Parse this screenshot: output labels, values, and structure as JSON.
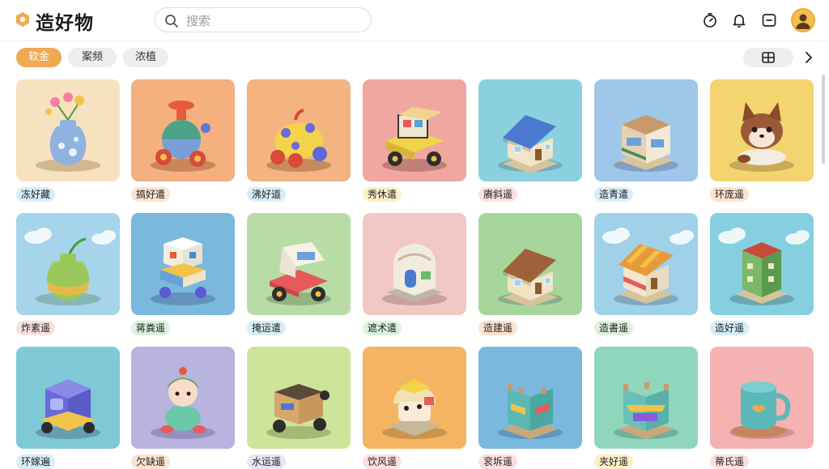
{
  "header": {
    "app_title": "造好物",
    "search": {
      "placeholder": "搜索",
      "value": ""
    },
    "icons": [
      "logo-icon",
      "search-icon",
      "timer-icon",
      "bell-icon",
      "message-icon",
      "user-avatar"
    ]
  },
  "chips": [
    {
      "label": "软金",
      "active": true
    },
    {
      "label": "案频",
      "active": false
    },
    {
      "label": "浓植",
      "active": false
    }
  ],
  "toolbar": {
    "view_icon": "grid-view-icon",
    "next_icon": "chevron-right-icon"
  },
  "colors": {
    "accent": "#f0a950",
    "chip_idle": "#eeeeee"
  },
  "grid": [
    {
      "label": "冻好藏",
      "bg": "#f7e2bf",
      "label_bg": "#d6eef8",
      "item": "vase-flowers"
    },
    {
      "label": "搞好遣",
      "bg": "#f5b07f",
      "label_bg": "#fbe3cf",
      "item": "toy-robot"
    },
    {
      "label": "沸好道",
      "bg": "#f3b482",
      "label_bg": "#d6eef8",
      "item": "toy-car-yellow"
    },
    {
      "label": "秀休遣",
      "bg": "#f0a7a0",
      "label_bg": "#fbf1c5",
      "item": "toy-truck"
    },
    {
      "label": "赓斜遥",
      "bg": "#8ad0df",
      "label_bg": "#fbe0e0",
      "item": "house-blue-roof"
    },
    {
      "label": "造青遣",
      "bg": "#9ec7ea",
      "label_bg": "#d6eef8",
      "item": "shop-building"
    },
    {
      "label": "环庞遥",
      "bg": "#f3d46f",
      "label_bg": "#fbe3cf",
      "item": "puppy"
    },
    {
      "label": "炸素遥",
      "bg": "#a5d4eb",
      "label_bg": "#fbe0e0",
      "item": "green-vase"
    },
    {
      "label": "蒋粪遥",
      "bg": "#7ab8dc",
      "label_bg": "#dcf2dc",
      "item": "toy-tower"
    },
    {
      "label": "掩运遣",
      "bg": "#b9dca7",
      "label_bg": "#d6eef8",
      "item": "toy-van"
    },
    {
      "label": "遮术遣",
      "bg": "#f2c8c4",
      "label_bg": "#dcf2dc",
      "item": "dome-house"
    },
    {
      "label": "造建遥",
      "bg": "#a7d69c",
      "label_bg": "#fbe3cf",
      "item": "cottage"
    },
    {
      "label": "造書遥",
      "bg": "#9fd1e8",
      "label_bg": "#dcf2dc",
      "item": "market-stall"
    },
    {
      "label": "造好遥",
      "bg": "#86cfe0",
      "label_bg": "#d6eef8",
      "item": "green-tower"
    },
    {
      "label": "环嫁遍",
      "bg": "#7fc9d6",
      "label_bg": "#d6eef8",
      "item": "purple-cube-car"
    },
    {
      "label": "欠缺遥",
      "bg": "#b9b4df",
      "label_bg": "#fbe3cf",
      "item": "doll"
    },
    {
      "label": "水运遥",
      "bg": "#cde49a",
      "label_bg": "#e5e5f5",
      "item": "wooden-cart"
    },
    {
      "label": "饮风遥",
      "bg": "#f5b461",
      "label_bg": "#fbe0e0",
      "item": "mushroom-house"
    },
    {
      "label": "衮坼遥",
      "bg": "#79b9e0",
      "label_bg": "#fbe0e0",
      "item": "castle-shop"
    },
    {
      "label": "夹好遥",
      "bg": "#8fd6bd",
      "label_bg": "#fbf1c5",
      "item": "castle-stall"
    },
    {
      "label": "蒂氏遥",
      "bg": "#f4b2b2",
      "label_bg": "#fbe0e0",
      "item": "teal-mug"
    }
  ]
}
